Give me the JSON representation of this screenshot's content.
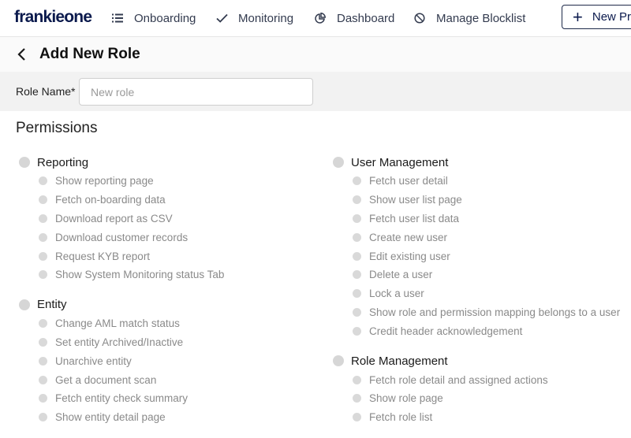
{
  "app": {
    "logo": "frankieone"
  },
  "nav": {
    "items": [
      {
        "label": "Onboarding",
        "icon": "list-icon"
      },
      {
        "label": "Monitoring",
        "icon": "check-icon"
      },
      {
        "label": "Dashboard",
        "icon": "pie-chart-icon"
      },
      {
        "label": "Manage Blocklist",
        "icon": "block-icon"
      }
    ],
    "new_button": {
      "label": "New Profile",
      "icon": "plus-icon"
    }
  },
  "page": {
    "title": "Add New Role"
  },
  "form": {
    "role_name_label": "Role Name*",
    "role_name_placeholder": "New role",
    "role_name_value": ""
  },
  "permissions": {
    "heading": "Permissions",
    "left_groups": [
      {
        "label": "Reporting",
        "items": [
          "Show reporting page",
          "Fetch on-boarding data",
          "Download report as CSV",
          "Download customer records",
          "Request KYB report",
          "Show System Monitoring status Tab"
        ]
      },
      {
        "label": "Entity",
        "items": [
          "Change AML match status",
          "Set entity Archived/Inactive",
          "Unarchive entity",
          "Get a document scan",
          "Fetch entity check summary",
          "Show entity detail page"
        ]
      }
    ],
    "right_groups": [
      {
        "label": "User Management",
        "items": [
          "Fetch user detail",
          "Show user list page",
          "Fetch user list data",
          "Create new user",
          "Edit existing user",
          "Delete a user",
          "Lock a user",
          "Show role and permission mapping belongs to a user",
          "Credit header acknowledgement"
        ]
      },
      {
        "label": "Role Management",
        "items": [
          "Fetch role detail and assigned actions",
          "Show role page",
          "Fetch role list"
        ]
      }
    ]
  },
  "colors": {
    "brand": "#0b1a4d",
    "checkbox_unchecked": "#d6d6d6",
    "muted_text": "#8a8a8a"
  }
}
